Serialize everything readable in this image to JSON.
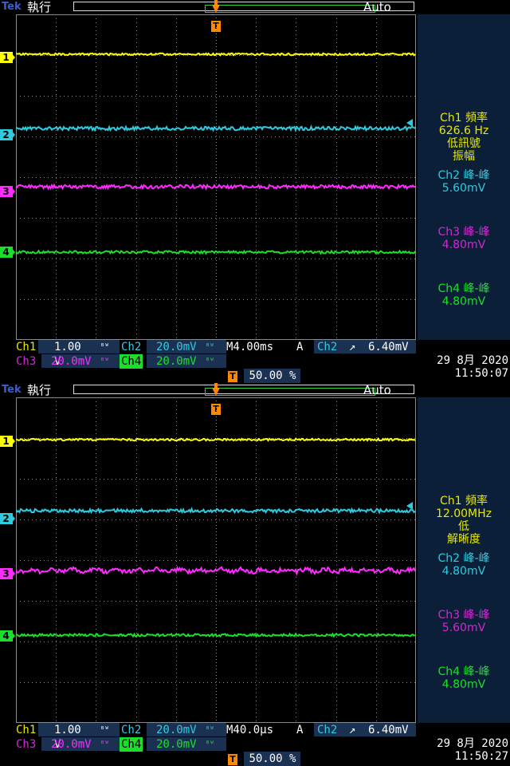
{
  "colors": {
    "ch1": "#ffff00",
    "ch2": "#2ecbe0",
    "ch3": "#ff2bff",
    "ch4": "#19e02a",
    "grid": "#8a8a8a",
    "panel": "#0b1f38",
    "trigger": "#ff8a00",
    "brand": "#3a5fc8"
  },
  "captures": [
    {
      "header": {
        "brand": "Tek",
        "run_state": "執行",
        "trigger_mode": "Auto",
        "trigger_marker": "T"
      },
      "channel_markers": [
        "1",
        "2",
        "3",
        "4"
      ],
      "measurements": [
        {
          "channel": "Ch1",
          "name": "頻率",
          "value": "626.6 Hz",
          "note1": "低訊號",
          "note2": "振幅"
        },
        {
          "channel": "Ch2",
          "name": "峰-峰",
          "value": "5.60mV"
        },
        {
          "channel": "Ch3",
          "name": "峰-峰",
          "value": "4.80mV"
        },
        {
          "channel": "Ch4",
          "name": "峰-峰",
          "value": "4.80mV"
        }
      ],
      "status": {
        "ch1_label": "Ch1",
        "ch1_scale": "1.00 V",
        "ch2_label": "Ch2",
        "ch2_scale": "20.0mV",
        "ch3_label": "Ch3",
        "ch3_scale": "20.0mV",
        "ch4_label": "Ch4",
        "ch4_scale": "20.0mV",
        "bw_symbol": "ᴮᵂ",
        "timebase": "M4.00ms",
        "trig_prefix": "A",
        "trig_source": "Ch2",
        "trig_slope": "↗",
        "trig_level": "6.40mV",
        "trig_pos_marker": "T",
        "trig_position": "50.00 %",
        "date": "29 8月  2020",
        "time": "11:50:07"
      }
    },
    {
      "header": {
        "brand": "Tek",
        "run_state": "執行",
        "trigger_mode": "Auto",
        "trigger_marker": "T"
      },
      "channel_markers": [
        "1",
        "2",
        "3",
        "4"
      ],
      "measurements": [
        {
          "channel": "Ch1",
          "name": "頻率",
          "value": "12.00MHz",
          "note1": "低",
          "note2": "解晰度"
        },
        {
          "channel": "Ch2",
          "name": "峰-峰",
          "value": "4.80mV"
        },
        {
          "channel": "Ch3",
          "name": "峰-峰",
          "value": "5.60mV"
        },
        {
          "channel": "Ch4",
          "name": "峰-峰",
          "value": "4.80mV"
        }
      ],
      "status": {
        "ch1_label": "Ch1",
        "ch1_scale": "1.00 V",
        "ch2_label": "Ch2",
        "ch2_scale": "20.0mV",
        "ch3_label": "Ch3",
        "ch3_scale": "20.0mV",
        "ch4_label": "Ch4",
        "ch4_scale": "20.0mV",
        "bw_symbol": "ᴮᵂ",
        "timebase": "M40.0µs",
        "trig_prefix": "A",
        "trig_source": "Ch2",
        "trig_slope": "↗",
        "trig_level": "6.40mV",
        "trig_pos_marker": "T",
        "trig_position": "50.00 %",
        "date": "29 8月  2020",
        "time": "11:50:27"
      }
    }
  ]
}
